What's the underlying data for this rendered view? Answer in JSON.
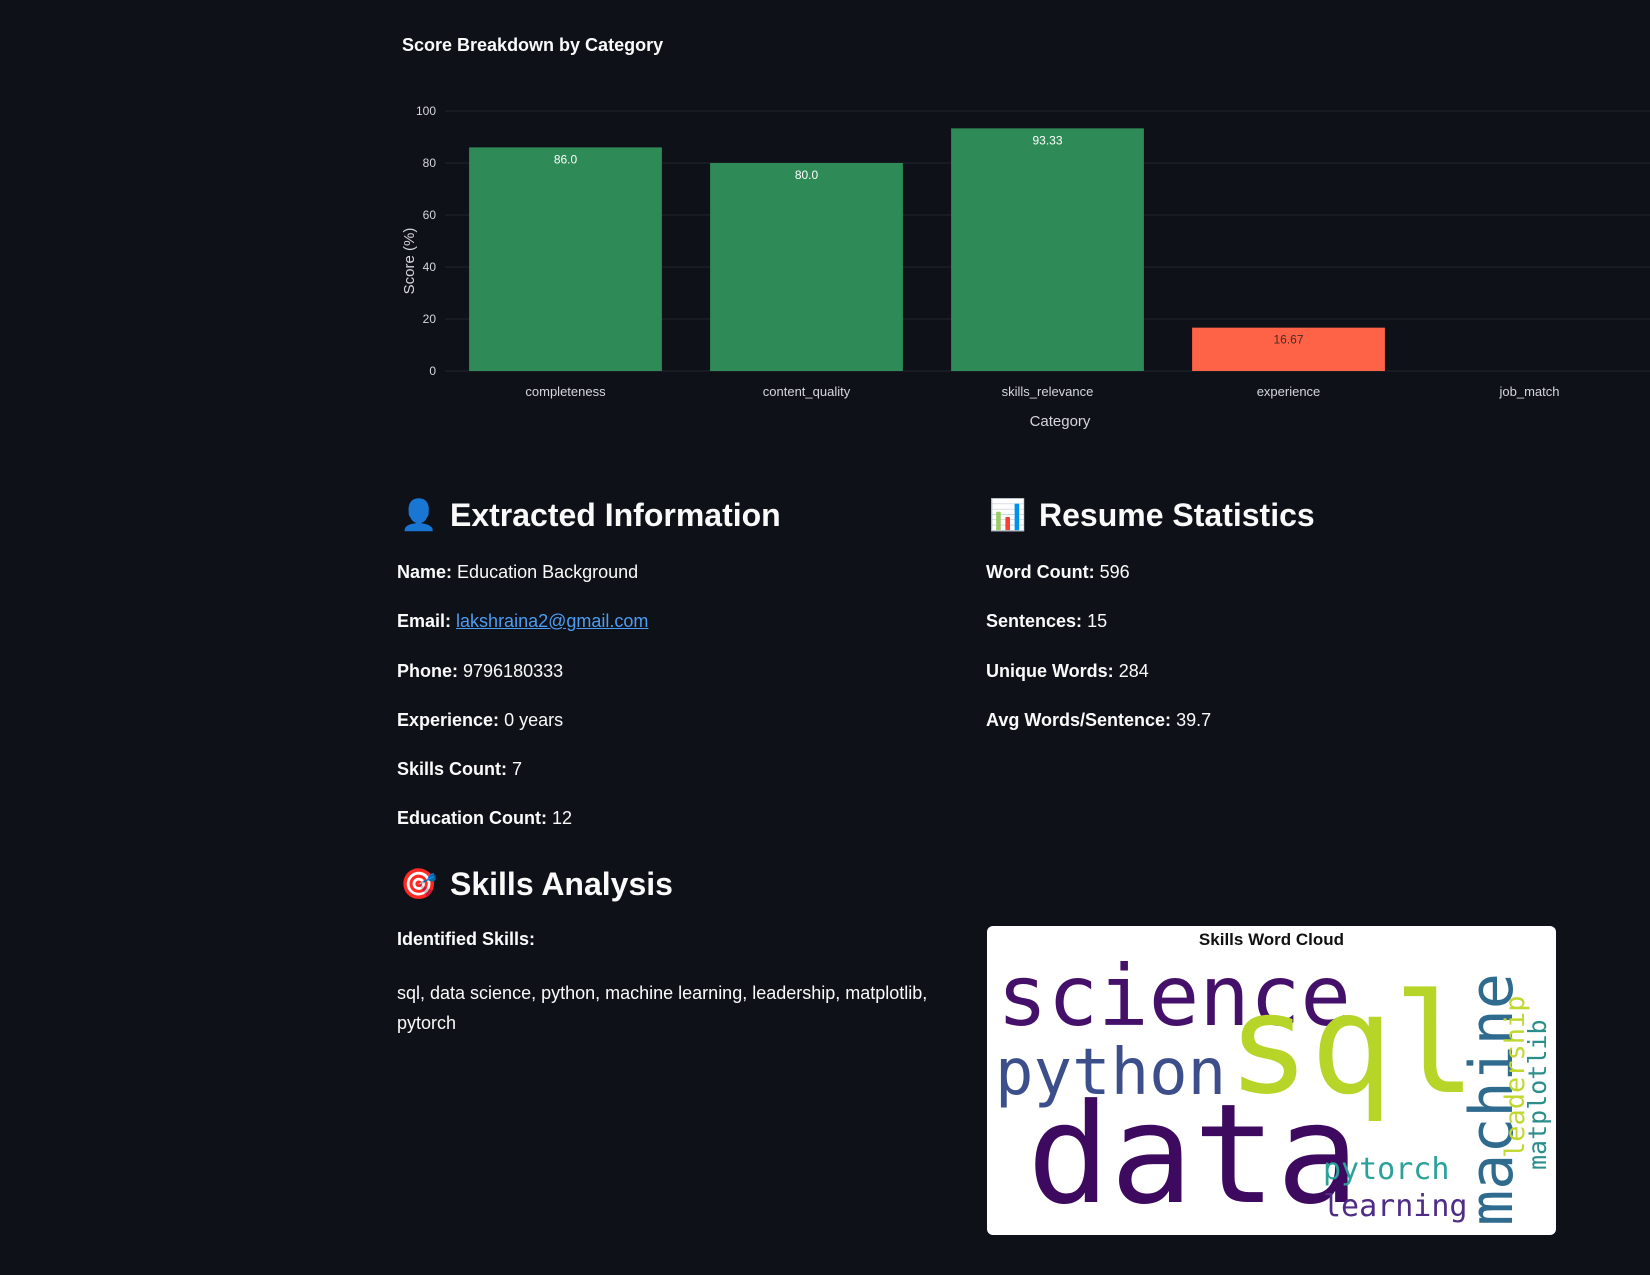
{
  "chart_data": {
    "type": "bar",
    "title": "Score Breakdown by Category",
    "xlabel": "Category",
    "ylabel": "Score (%)",
    "ylim": [
      0,
      100
    ],
    "yticks": [
      0,
      20,
      40,
      60,
      80,
      100
    ],
    "categories": [
      "completeness",
      "content_quality",
      "skills_relevance",
      "experience",
      "job_match"
    ],
    "values": [
      86.0,
      80.0,
      93.33,
      16.67,
      0
    ],
    "value_labels": [
      "86.0",
      "80.0",
      "93.33",
      "16.67",
      ""
    ],
    "colors": [
      "#2e8b57",
      "#2e8b57",
      "#2e8b57",
      "#ff6347",
      "#ff6347"
    ],
    "grid": true
  },
  "extracted": {
    "icon": "person-silhouette-icon",
    "title": "Extracted Information",
    "fields": [
      {
        "label": "Name:",
        "value": "Education Background"
      },
      {
        "label": "Email:",
        "value": "lakshraina2@gmail.com"
      },
      {
        "label": "Phone:",
        "value": "9796180333"
      },
      {
        "label": "Experience:",
        "value": "0 years"
      },
      {
        "label": "Skills Count:",
        "value": "7"
      },
      {
        "label": "Education Count:",
        "value": "12"
      }
    ]
  },
  "stats": {
    "icon": "bar-chart-icon",
    "title": "Resume Statistics",
    "fields": [
      {
        "label": "Word Count:",
        "value": "596"
      },
      {
        "label": "Sentences:",
        "value": "15"
      },
      {
        "label": "Unique Words:",
        "value": "284"
      },
      {
        "label": "Avg Words/Sentence:",
        "value": "39.7"
      }
    ]
  },
  "skills": {
    "icon": "target-icon",
    "title": "Skills Analysis",
    "identified_label": "Identified Skills:",
    "list_text": "sql, data science, python, machine learning, leadership, matplotlib, pytorch"
  },
  "wordcloud": {
    "title": "Skills Word Cloud",
    "words": [
      "science",
      "sql",
      "python",
      "data",
      "machine",
      "leadership",
      "matplotlib",
      "pytorch",
      "learning"
    ]
  }
}
